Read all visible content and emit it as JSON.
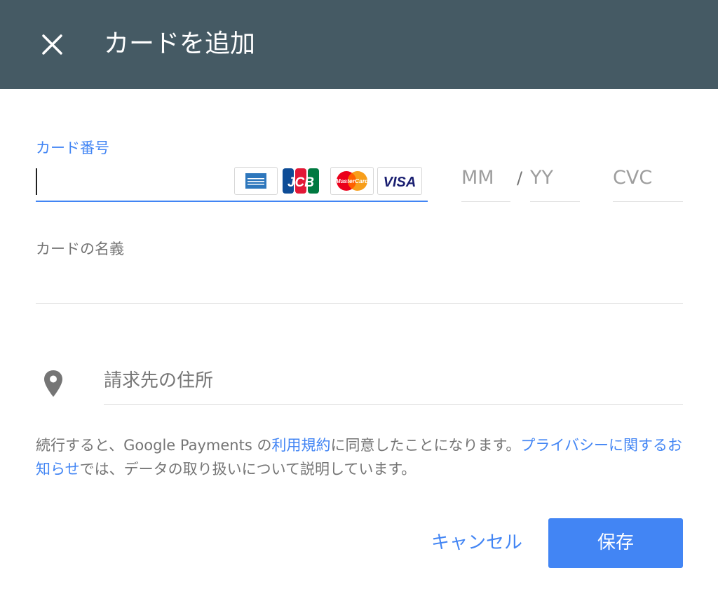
{
  "dialog": {
    "title": "カードを追加",
    "close_icon": "close-icon"
  },
  "card_number": {
    "label": "カード番号",
    "value": "",
    "logos": [
      {
        "name": "amex",
        "text": "AMERICAN EXPRESS",
        "color": "#2e77bc"
      },
      {
        "name": "jcb",
        "text": "JCB",
        "colors": [
          "#0e4c96",
          "#e21836",
          "#007940"
        ]
      },
      {
        "name": "mastercard",
        "text": "MasterCard",
        "colors": [
          "#eb001b",
          "#f79e1b"
        ]
      },
      {
        "name": "visa",
        "text": "VISA",
        "color": "#1a1f71"
      }
    ]
  },
  "expiry": {
    "month_placeholder": "MM",
    "separator": "/",
    "year_placeholder": "YY"
  },
  "cvc": {
    "placeholder": "CVC"
  },
  "cardholder": {
    "label": "カードの名義",
    "value": ""
  },
  "billing_address": {
    "icon": "location-pin-icon",
    "placeholder": "請求先の住所"
  },
  "notice": {
    "text_before": "続行すると、Google Payments の",
    "terms_link": "利用規約",
    "text_middle": "に同意したことになります。",
    "privacy_link": "プライバシーに関するお知らせ",
    "text_after": "では、データの取り扱いについて説明しています。"
  },
  "actions": {
    "cancel_label": "キャンセル",
    "save_label": "保存"
  },
  "colors": {
    "header_bg": "#455a64",
    "accent": "#4285f4",
    "secondary_text": "#757575"
  }
}
